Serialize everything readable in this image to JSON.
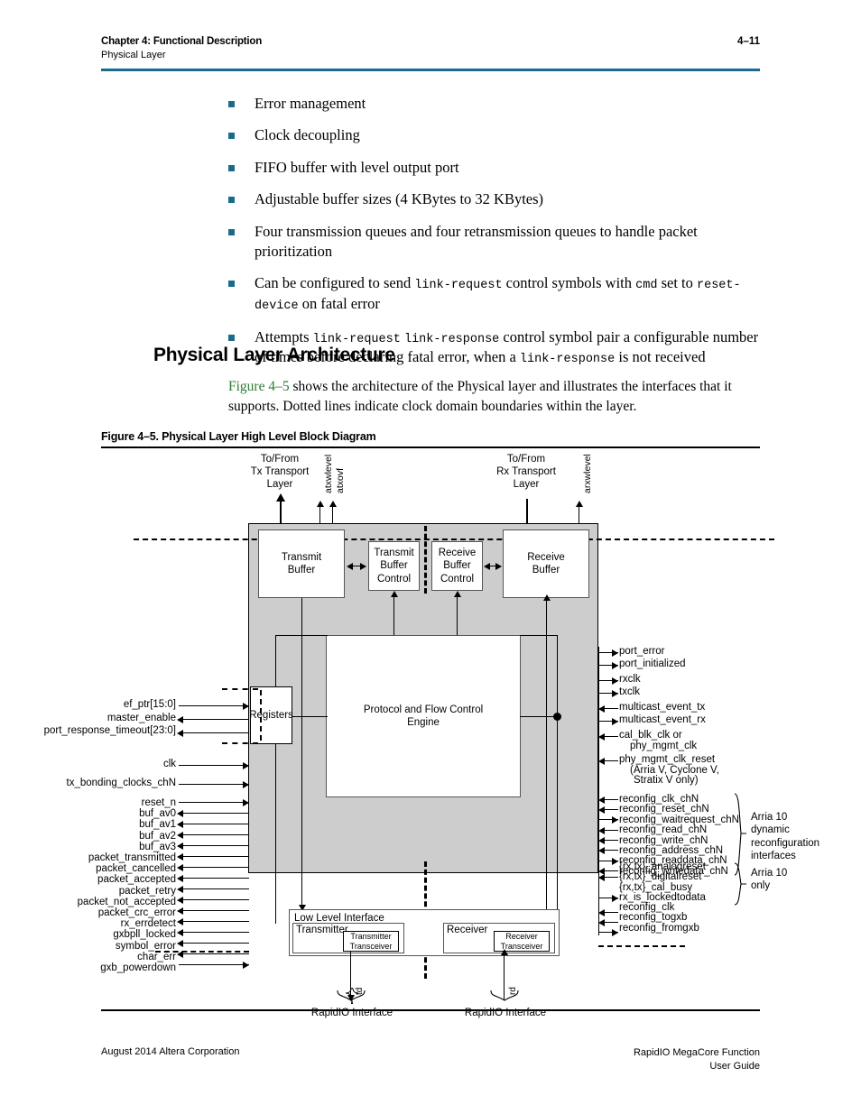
{
  "header": {
    "chapter": "Chapter 4:  Functional Description",
    "section": "Physical Layer",
    "page_number": "4–11",
    "rule_color": "#1a6a8e"
  },
  "bullets": [
    "Error management",
    "Clock decoupling",
    "FIFO buffer with level output port",
    "Adjustable buffer sizes (4 KBytes to 32 KBytes)",
    "Four transmission queues and four retransmission queues to handle packet prioritization"
  ],
  "bullet_rich": {
    "link_request_1": {
      "a": "Can be configured to send ",
      "code1": "link-request",
      "b": " control symbols with ",
      "code2": "cmd",
      "c": " set to ",
      "code3": "reset-device",
      "d": " on fatal error"
    },
    "link_request_2": {
      "a": "Attempts ",
      "code1": "link-request",
      "b": " ",
      "code2": "link-response",
      "c": " control symbol pair a configurable number of times before declaring fatal error, when a ",
      "code3": "link-response",
      "d": " is not received"
    }
  },
  "section": {
    "heading": "Physical Layer Architecture",
    "para_xref": "Figure 4–5",
    "para_rest": " shows the architecture of the Physical layer and illustrates the interfaces that it supports. Dotted lines indicate clock domain boundaries within the layer."
  },
  "figure": {
    "caption": "Figure 4–5.  Physical Layer High Level Block Diagram",
    "top_labels": {
      "tx_transport": "To/From\nTx Transport\nLayer",
      "tx_transport_l1": "To/From",
      "tx_transport_l2": "Tx Transport",
      "tx_transport_l3": "Layer",
      "rx_transport_l1": "To/From",
      "rx_transport_l2": "Rx Transport",
      "rx_transport_l3": "Layer",
      "atxwlevel": "atxwlevel",
      "atxovf": "atxovf",
      "arxwlevel": "arxwlevel"
    },
    "blocks": {
      "transmit_buffer_l1": "Transmit",
      "transmit_buffer_l2": "Buffer",
      "transmit_buffer_control_l1": "Transmit",
      "transmit_buffer_control_l2": "Buffer",
      "transmit_buffer_control_l3": "Control",
      "receive_buffer_control_l1": "Receive",
      "receive_buffer_control_l2": "Buffer",
      "receive_buffer_control_l3": "Control",
      "receive_buffer_l1": "Receive",
      "receive_buffer_l2": "Buffer",
      "engine_l1": "Protocol and Flow Control",
      "engine_l2": "Engine",
      "registers": "Registers",
      "low_level_interface": "Low Level Interface",
      "transmitter": "Transmitter",
      "receiver": "Receiver",
      "transmitter_transceiver_l1": "Transmitter",
      "transmitter_transceiver_l2": "Transceiver",
      "receiver_transceiver_l1": "Receiver",
      "receiver_transceiver_l2": "Transceiver"
    },
    "left_register_signals": [
      "ef_ptr[15:0]",
      "master_enable",
      "port_response_timeout[23:0]"
    ],
    "left_clk_signals": [
      "clk",
      "tx_bonding_clocks_chN"
    ],
    "left_signals": [
      "reset_n",
      "buf_av0",
      "buf_av1",
      "buf_av2",
      "buf_av3",
      "packet_transmitted",
      "packet_cancelled",
      "packet_accepted",
      "packet_retry",
      "packet_not_accepted",
      "packet_crc_error",
      "rx_errdetect",
      "gxbpll_locked",
      "symbol_error",
      "char_err",
      "gxb_powerdown"
    ],
    "right_signals_group1": [
      "port_error",
      "port_initialized"
    ],
    "right_signals_group2": [
      "rxclk",
      "txclk"
    ],
    "right_signals_group3": [
      "multicast_event_tx",
      "multicast_event_rx"
    ],
    "right_signals_group4_l1": "cal_blk_clk or",
    "right_signals_group4_l2": "phy_mgmt_clk",
    "right_signals_group5_l1": "phy_mgmt_clk_reset",
    "right_signals_group5_l2": "(Arria V, Cyclone V,",
    "right_signals_group5_l3": "Stratix V only)",
    "reconfig_signals": [
      "reconfig_clk_chN",
      "reconfig_reset_chN",
      "reconfig_waitrequest_chN",
      "reconfig_read_chN",
      "reconfig_write_chN",
      "reconfig_address_chN",
      "reconfig_readdata_chN",
      "reconfig_writedata_chN"
    ],
    "reconfig_brace_l1": "Arria 10",
    "reconfig_brace_l2": "dynamic",
    "reconfig_brace_l3": "reconfiguration",
    "reconfig_brace_l4": "interfaces",
    "arria10_signals": [
      "{rx,tx}_analogreset",
      "{rx,tx}_digitalreset",
      "{rx,tx}_cal_busy",
      "rx_is_lockedtodata"
    ],
    "arria10_brace_l1": "Arria 10",
    "arria10_brace_l2": "only",
    "bottom_right_signals": [
      "reconfig_clk",
      "reconfig_togxb",
      "reconfig_fromgxb"
    ],
    "bottom_labels": {
      "td": "td",
      "rd": "rd",
      "rapidio_left": "RapidIO Interface",
      "rapidio_right": "RapidIO Interface"
    }
  },
  "footer": {
    "left": "August 2014   Altera Corporation",
    "right_l1": "RapidIO MegaCore Function",
    "right_l2": "User Guide"
  }
}
